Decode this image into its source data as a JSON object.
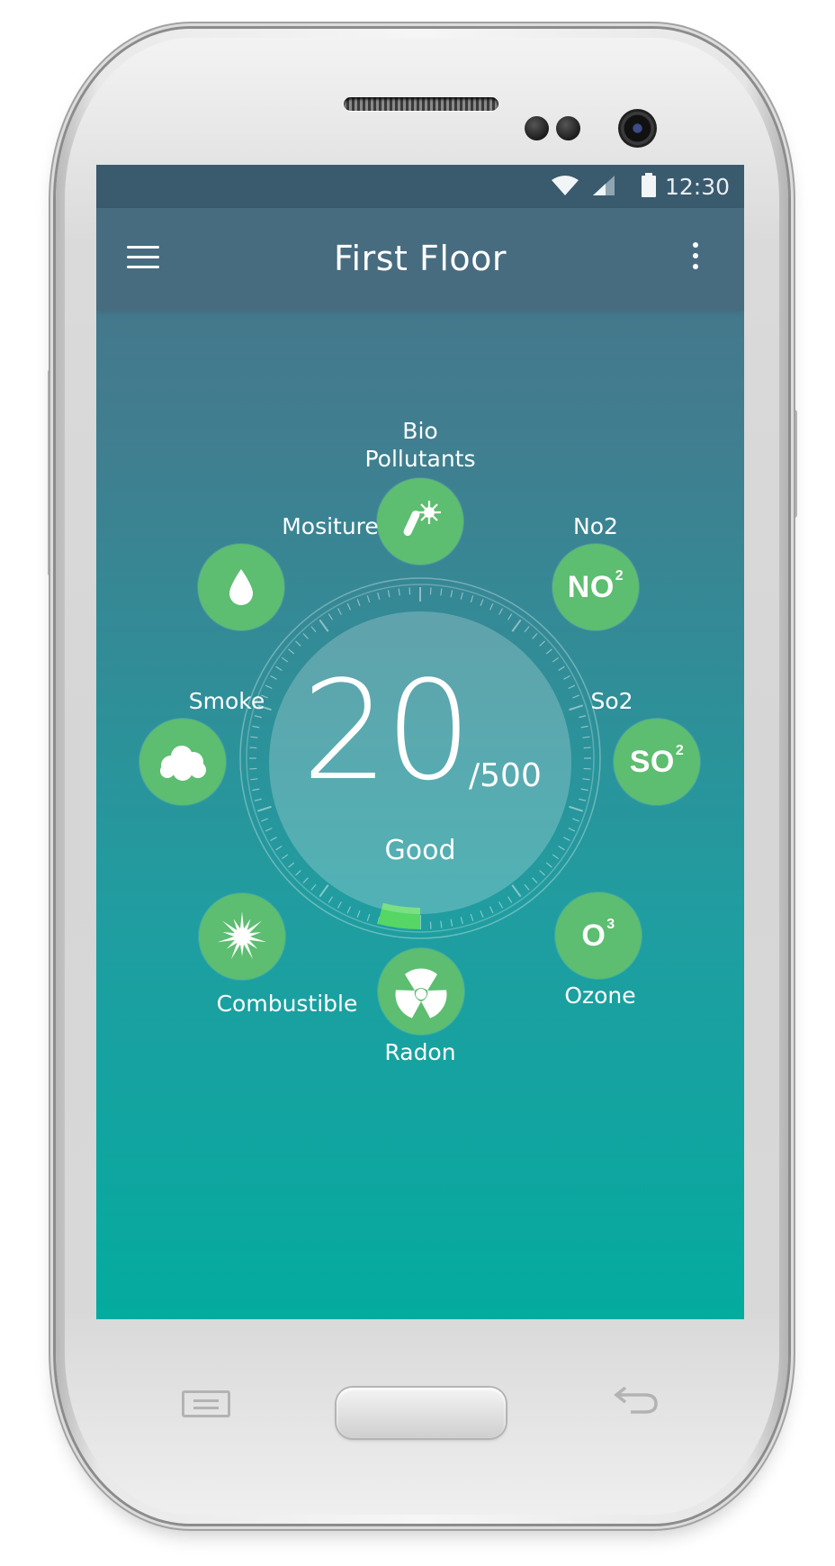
{
  "status_bar": {
    "time": "12:30",
    "icons": [
      "wifi-icon",
      "signal-icon",
      "battery-icon"
    ]
  },
  "app_bar": {
    "title": "First Floor",
    "nav_icon": "hamburger-icon",
    "menu_icon": "overflow-icon"
  },
  "gauge": {
    "value": "20",
    "max_text": "/500",
    "status": "Good",
    "fraction": 0.04,
    "indicator_color": "#56d664"
  },
  "pollutants": [
    {
      "id": "bio",
      "label_line1": "Bio",
      "label_line2": "Pollutants",
      "icon": "bio-pollutants-icon"
    },
    {
      "id": "no2",
      "label": "No2",
      "chem_main": "NO",
      "chem_sup": "2",
      "icon": "no2-icon"
    },
    {
      "id": "so2",
      "label": "So2",
      "chem_main": "SO",
      "chem_sup": "2",
      "icon": "so2-icon"
    },
    {
      "id": "ozone",
      "label": "Ozone",
      "chem_main": "O",
      "chem_sup": "3",
      "icon": "ozone-icon"
    },
    {
      "id": "radon",
      "label": "Radon",
      "icon": "radon-icon"
    },
    {
      "id": "combustible",
      "label": "Combustible",
      "icon": "combustible-icon"
    },
    {
      "id": "smoke",
      "label": "Smoke",
      "icon": "smoke-icon"
    },
    {
      "id": "moisture",
      "label": "Mositure",
      "icon": "moisture-drop-icon"
    }
  ],
  "colors": {
    "screen_top": "#4a7188",
    "screen_bottom": "#04ab9f",
    "app_bar": "#476c80",
    "status_bar": "#3a5a6e",
    "node": "#5dbd70"
  }
}
